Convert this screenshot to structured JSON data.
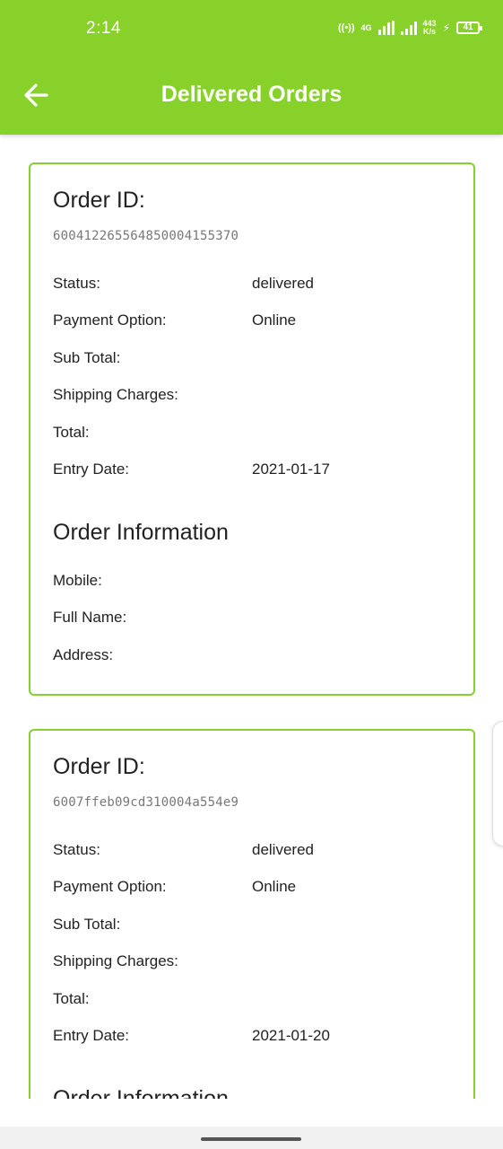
{
  "statusbar": {
    "time": "2:14",
    "network_type": "4G",
    "speed_value": "443",
    "speed_unit": "K/s",
    "battery": "41"
  },
  "header": {
    "title": "Delivered Orders"
  },
  "labels": {
    "order_id": "Order ID:",
    "status": "Status:",
    "payment_option": "Payment Option:",
    "sub_total": "Sub Total:",
    "shipping_charges": "Shipping Charges:",
    "total": "Total:",
    "entry_date": "Entry Date:",
    "order_information": "Order Information",
    "mobile": "Mobile:",
    "full_name": "Full Name:",
    "address": "Address:"
  },
  "orders": [
    {
      "id": "600412265564850004155370",
      "status": "delivered",
      "payment_option": "Online",
      "sub_total": "",
      "shipping_charges": "",
      "total": "",
      "entry_date": "2021-01-17",
      "mobile": "",
      "full_name": "",
      "address": ""
    },
    {
      "id": "6007ffeb09cd310004a554e9",
      "status": "delivered",
      "payment_option": "Online",
      "sub_total": "",
      "shipping_charges": "",
      "total": "",
      "entry_date": "2021-01-20"
    }
  ],
  "colors": {
    "accent": "#88d12b",
    "text": "#222222",
    "muted": "#777777"
  }
}
